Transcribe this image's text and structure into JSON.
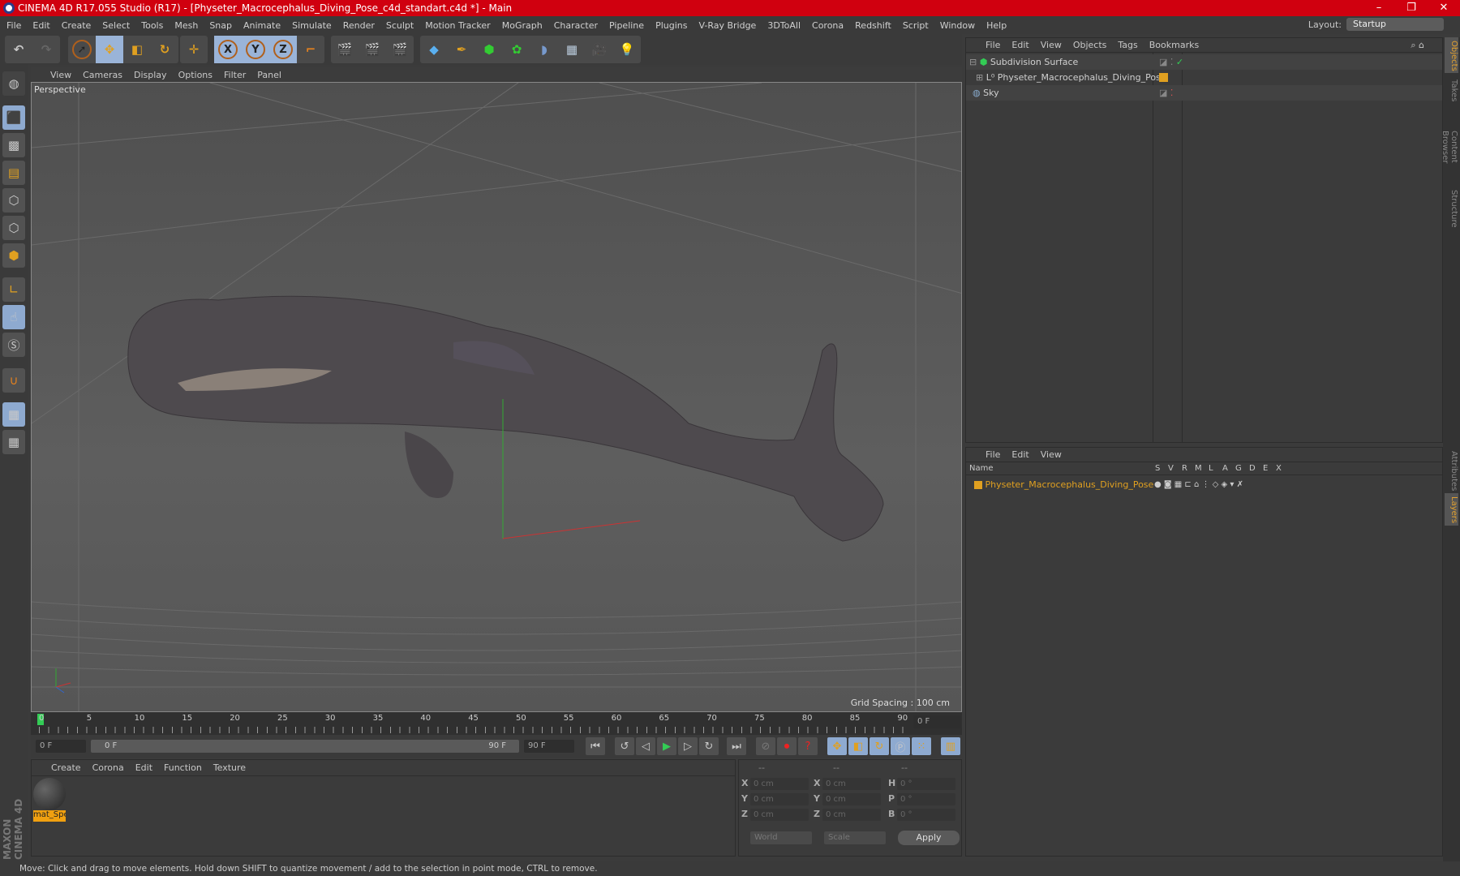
{
  "title": "CINEMA 4D R17.055 Studio (R17) - [Physeter_Macrocephalus_Diving_Pose_c4d_standart.c4d *] - Main",
  "window_controls": {
    "minimize": "–",
    "restore": "❐",
    "close": "✕"
  },
  "menu": [
    "File",
    "Edit",
    "Create",
    "Select",
    "Tools",
    "Mesh",
    "Snap",
    "Animate",
    "Simulate",
    "Render",
    "Sculpt",
    "Motion Tracker",
    "MoGraph",
    "Character",
    "Pipeline",
    "Plugins",
    "V-Ray Bridge",
    "3DToAll",
    "Corona",
    "Redshift",
    "Script",
    "Window",
    "Help"
  ],
  "layout": {
    "label": "Layout:",
    "value": "Startup"
  },
  "toolbar": {
    "x": "X",
    "y": "Y",
    "z": "Z"
  },
  "viewport": {
    "menu": [
      "View",
      "Cameras",
      "Display",
      "Options",
      "Filter",
      "Panel"
    ],
    "label": "Perspective",
    "grid_spacing": "Grid Spacing : 100 cm"
  },
  "timeline": {
    "ticks": [
      "0",
      "5",
      "10",
      "15",
      "20",
      "25",
      "30",
      "35",
      "40",
      "45",
      "50",
      "55",
      "60",
      "65",
      "70",
      "75",
      "80",
      "85",
      "90"
    ],
    "current": "0 F",
    "start": "0 F",
    "range_start": "0 F",
    "range_end": "90 F",
    "end": "90 F"
  },
  "materials": {
    "menu": [
      "Create",
      "Corona",
      "Edit",
      "Function",
      "Texture"
    ],
    "items": [
      {
        "name": "mat_Spe"
      }
    ]
  },
  "coords": {
    "headers": [
      "--",
      "--",
      "--"
    ],
    "rows": [
      {
        "a": "X",
        "av": "0 cm",
        "b": "X",
        "bv": "0 cm",
        "c": "H",
        "cv": "0 °"
      },
      {
        "a": "Y",
        "av": "0 cm",
        "b": "Y",
        "bv": "0 cm",
        "c": "P",
        "cv": "0 °"
      },
      {
        "a": "Z",
        "av": "0 cm",
        "b": "Z",
        "bv": "0 cm",
        "c": "B",
        "cv": "0 °"
      }
    ],
    "space": "World",
    "mode": "Scale",
    "apply": "Apply"
  },
  "objects": {
    "menu": [
      "File",
      "Edit",
      "View",
      "Objects",
      "Tags",
      "Bookmarks"
    ],
    "items": [
      {
        "name": "Subdivision Surface"
      },
      {
        "name": "Physeter_Macrocephalus_Diving_Pose"
      },
      {
        "name": "Sky"
      }
    ]
  },
  "layers": {
    "menu": [
      "File",
      "Edit",
      "View"
    ],
    "columns": [
      "Name",
      "S",
      "V",
      "R",
      "M",
      "L",
      "A",
      "G",
      "D",
      "E",
      "X"
    ],
    "items": [
      {
        "name": "Physeter_Macrocephalus_Diving_Pose",
        "color": "#e0a020"
      }
    ]
  },
  "right_tabs": [
    "Objects",
    "Takes",
    "Content Browser",
    "Structure",
    "Attributes",
    "Layers"
  ],
  "brand": "MAXON CINEMA 4D",
  "status": "Move: Click and drag to move elements. Hold down SHIFT to quantize movement / add to the selection in point mode, CTRL to remove."
}
